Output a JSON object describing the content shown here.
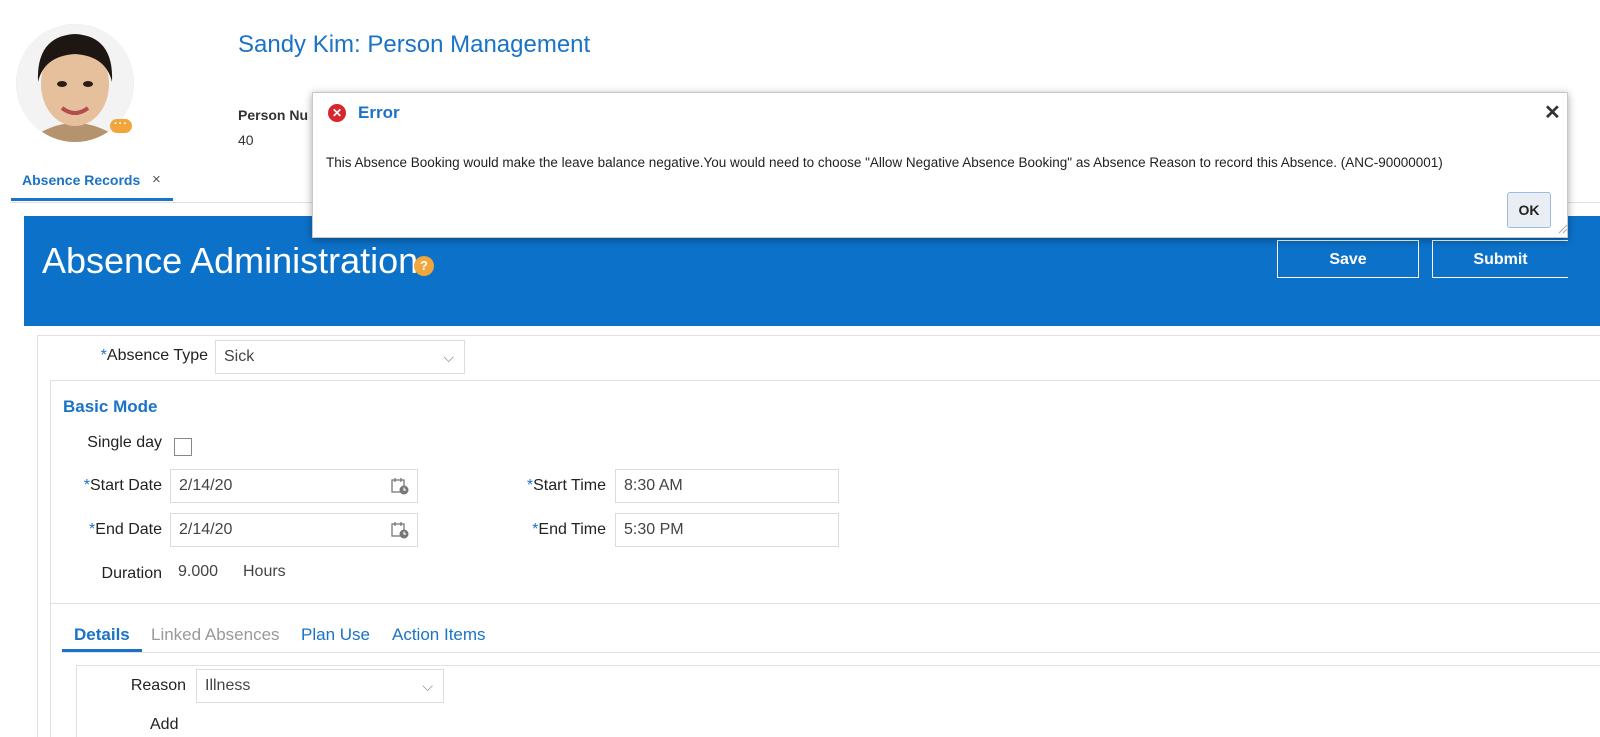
{
  "header": {
    "title": "Sandy Kim: Person Management",
    "person_number_label": "Person Nu",
    "person_number_value": "40",
    "avatar_badge": "···"
  },
  "tabs": {
    "active_label": "Absence Records",
    "close_glyph": "×"
  },
  "banner": {
    "title": "Absence Administration",
    "help_glyph": "?",
    "save_label": "Save",
    "submit_label": "Submit"
  },
  "form": {
    "absence_type_label": "Absence Type",
    "absence_type_value": "Sick",
    "mode_title": "Basic Mode",
    "single_day_label": "Single day",
    "start_date_label": "Start Date",
    "start_date_value": "2/14/20",
    "end_date_label": "End Date",
    "end_date_value": "2/14/20",
    "start_time_label": "Start Time",
    "start_time_value": "8:30 AM",
    "end_time_label": "End Time",
    "end_time_value": "5:30 PM",
    "duration_label": "Duration",
    "duration_value": "9.000",
    "duration_unit": "Hours",
    "required_marker": "*"
  },
  "subtabs": [
    {
      "label": "Details"
    },
    {
      "label": "Linked Absences"
    },
    {
      "label": "Plan Use"
    },
    {
      "label": "Action Items"
    }
  ],
  "details": {
    "reason_label": "Reason",
    "reason_value": "Illness",
    "partial_label": "Add"
  },
  "dialog": {
    "title": "Error",
    "error_glyph": "✕",
    "close_glyph": "✕",
    "message": "This Absence Booking would make the leave balance negative.You would need to choose \"Allow Negative Absence Booking\" as Absence Reason to record this Absence. (ANC-90000001)",
    "ok_label": "OK"
  },
  "colors": {
    "accent": "#1a73c7",
    "banner": "#0c72c9",
    "error": "#d9262c",
    "help": "#f0a63c"
  }
}
